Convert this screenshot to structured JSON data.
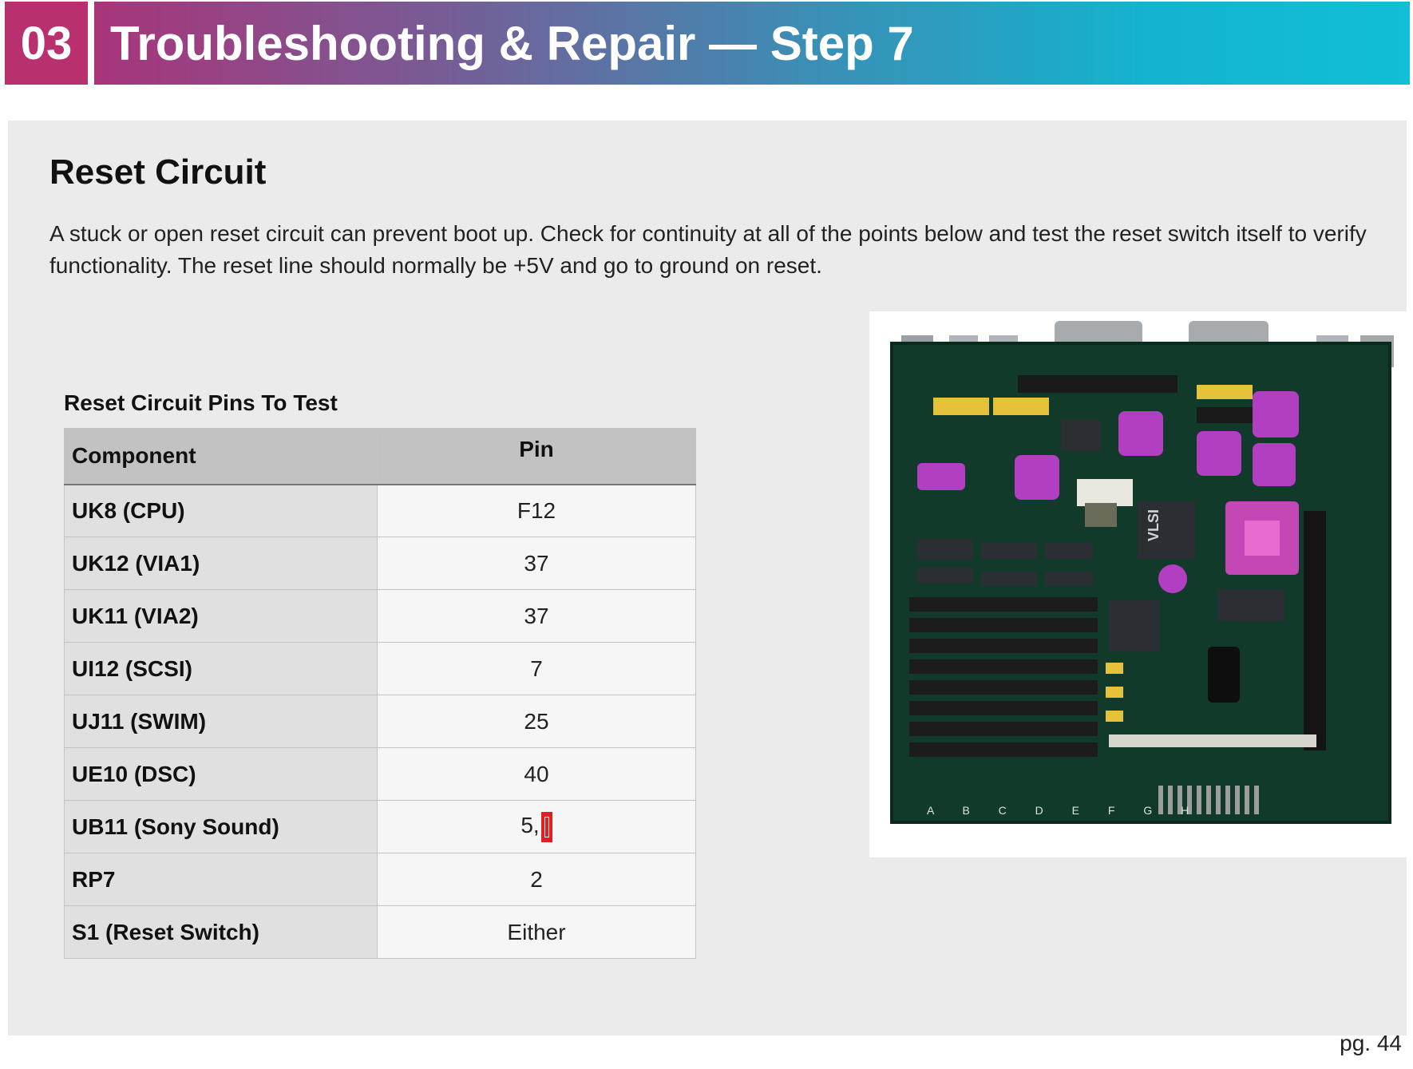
{
  "header": {
    "chapter_number": "03",
    "title": "Troubleshooting & Repair  —  Step 7"
  },
  "section": {
    "title": "Reset Circuit",
    "intro": "A stuck or open reset circuit can prevent boot up. Check for continuity at all of the points below and test the reset switch itself to verify functionality. The reset line should normally be +5V and go to ground on reset."
  },
  "table": {
    "caption": "Reset Circuit Pins To Test",
    "headers": {
      "component": "Component",
      "pin": "Pin"
    },
    "rows": [
      {
        "component": "UK8 (CPU)",
        "pin": "F12"
      },
      {
        "component": "UK12 (VIA1)",
        "pin": "37"
      },
      {
        "component": "UK11 (VIA2)",
        "pin": "37"
      },
      {
        "component": "UI12 (SCSI)",
        "pin": "7"
      },
      {
        "component": "UJ11 (SWIM)",
        "pin": "25"
      },
      {
        "component": "UE10 (DSC)",
        "pin": "40"
      },
      {
        "component": "UB11 (Sony Sound)",
        "pin": "5,"
      },
      {
        "component": "RP7",
        "pin": "2"
      },
      {
        "component": "S1 (Reset Switch)",
        "pin": "Either"
      }
    ]
  },
  "photo": {
    "board_silkscreen_left": "A B C D E F G H",
    "board_chip_label": "VLSI"
  },
  "colors": {
    "chapter_box": "#b8306d",
    "gradient_start": "#a8357a",
    "gradient_end": "#11bfd6",
    "panel": "#ebebeb",
    "board": "#123a2a",
    "chip_magenta": "#b23fc2"
  },
  "footer": {
    "page": "pg. 44"
  }
}
